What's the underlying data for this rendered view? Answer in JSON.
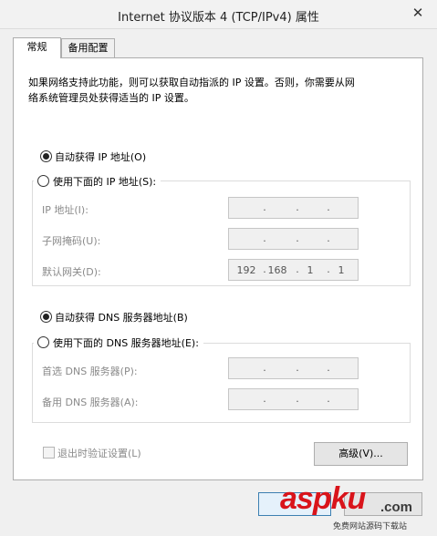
{
  "window": {
    "title": "Internet 协议版本 4 (TCP/IPv4) 属性",
    "close_glyph": "✕"
  },
  "tabs": [
    {
      "label": "常规"
    },
    {
      "label": "备用配置"
    }
  ],
  "description": {
    "line1": "如果网络支持此功能，则可以获取自动指派的 IP 设置。否则，你需要从网",
    "line2": "络系统管理员处获得适当的 IP 设置。"
  },
  "ip_section": {
    "auto_label": "自动获得 IP 地址(O)",
    "manual_label": "使用下面的 IP 地址(S):",
    "fields": [
      {
        "label": "IP 地址(I):",
        "value": [
          "",
          "",
          "",
          ""
        ]
      },
      {
        "label": "子网掩码(U):",
        "value": [
          "",
          "",
          "",
          ""
        ]
      },
      {
        "label": "默认网关(D):",
        "value": [
          "192",
          "168",
          "1",
          "1"
        ]
      }
    ]
  },
  "dns_section": {
    "auto_label": "自动获得 DNS 服务器地址(B)",
    "manual_label": "使用下面的 DNS 服务器地址(E):",
    "fields": [
      {
        "label": "首选 DNS 服务器(P):",
        "value": [
          "",
          "",
          "",
          ""
        ]
      },
      {
        "label": "备用 DNS 服务器(A):",
        "value": [
          "",
          "",
          "",
          ""
        ]
      }
    ]
  },
  "validate_label": "退出时验证设置(L)",
  "advanced_label": "高级(V)...",
  "watermark": {
    "text": "aspku",
    "suffix": ".com",
    "sub": "免费网站源码下载站"
  },
  "colors": {
    "watermark_red": "#d9141b",
    "watermark_dark": "#3a3a3a"
  }
}
